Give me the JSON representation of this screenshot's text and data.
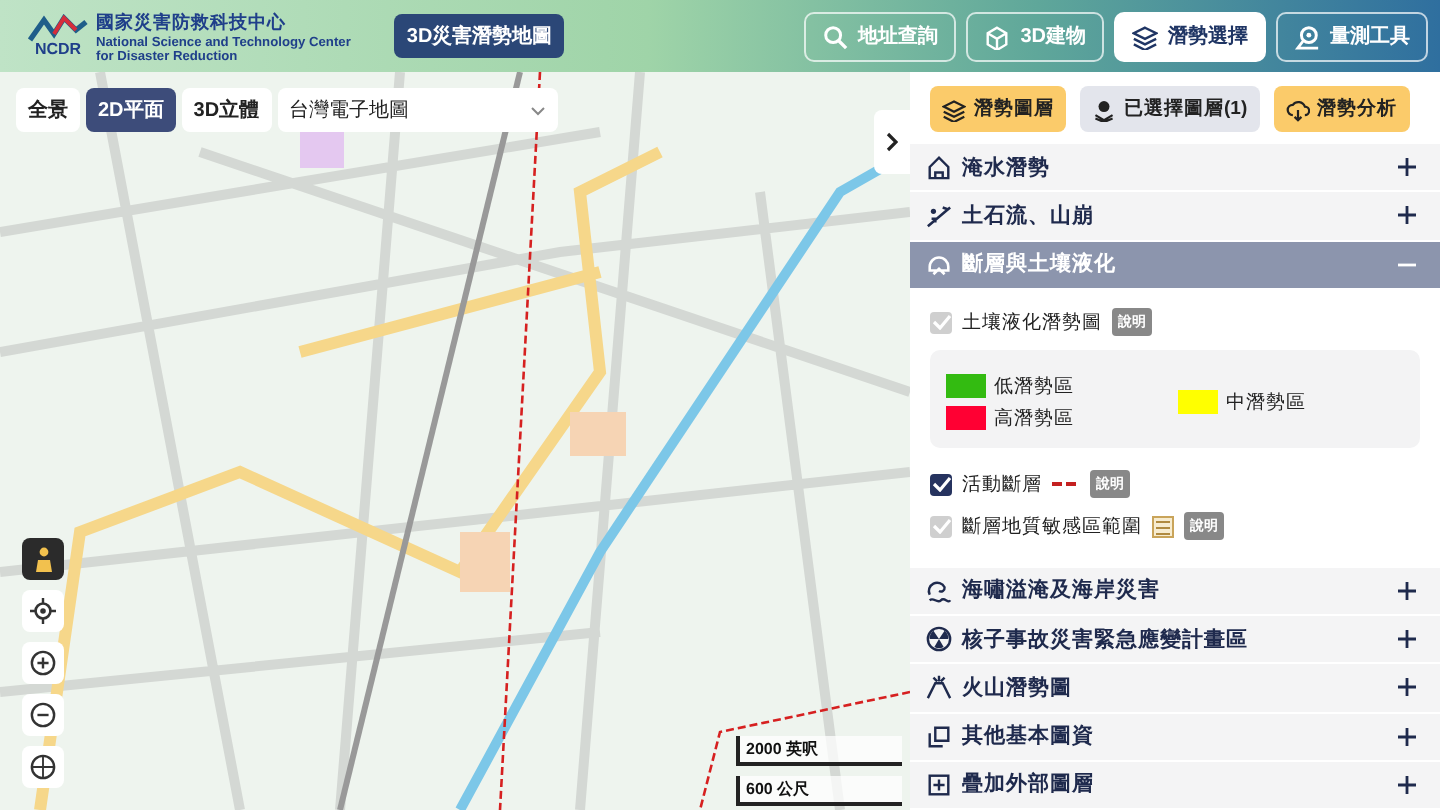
{
  "header": {
    "logo": {
      "acronym": "NCDR",
      "name_zh": "國家災害防救科技中心",
      "name_en_1": "National Science and Technology Center",
      "name_en_2": "for Disaster Reduction"
    },
    "app_title": "3D災害潛勢地圖",
    "nav": [
      {
        "label": "地址查詢",
        "selected": false
      },
      {
        "label": "3D建物",
        "selected": false
      },
      {
        "label": "潛勢選擇",
        "selected": true
      },
      {
        "label": "量測工具",
        "selected": false
      }
    ]
  },
  "map": {
    "view_modes": [
      {
        "label": "全景",
        "selected": false
      },
      {
        "label": "2D平面",
        "selected": true
      },
      {
        "label": "3D立體",
        "selected": false
      }
    ],
    "basemap": {
      "value": "台灣電子地圖"
    },
    "scale": [
      "2000 英呎",
      "600 公尺"
    ]
  },
  "panel": {
    "tabs": [
      {
        "label": "潛勢圖層",
        "color": "#fbcb6a"
      },
      {
        "label": "已選擇圖層(1)",
        "color": "#e3e5ec"
      },
      {
        "label": "潛勢分析",
        "color": "#fbcb6a"
      }
    ],
    "sections": [
      {
        "title": "淹水潛勢",
        "expanded": false
      },
      {
        "title": "土石流、山崩",
        "expanded": false
      },
      {
        "title": "斷層與土壤液化",
        "expanded": true,
        "layers": [
          {
            "label": "土壤液化潛勢圖",
            "checked": true,
            "disabled": true,
            "kind": "legend",
            "info": "說明",
            "legend": [
              {
                "label": "低潛勢區",
                "color": "#33bb11"
              },
              {
                "label": "中潛勢區",
                "color": "#ffff00"
              },
              {
                "label": "高潛勢區",
                "color": "#ff0033"
              }
            ]
          },
          {
            "label": "活動斷層",
            "checked": true,
            "disabled": false,
            "kind": "line",
            "info": "說明"
          },
          {
            "label": "斷層地質敏感區範圍",
            "checked": true,
            "disabled": true,
            "kind": "pattern",
            "info": "說明"
          }
        ]
      },
      {
        "title": "海嘯溢淹及海岸災害",
        "expanded": false
      },
      {
        "title": "核子事故災害緊急應變計畫區",
        "expanded": false
      },
      {
        "title": "火山潛勢圖",
        "expanded": false
      },
      {
        "title": "其他基本圖資",
        "expanded": false
      },
      {
        "title": "疊加外部圖層",
        "expanded": false
      }
    ]
  }
}
